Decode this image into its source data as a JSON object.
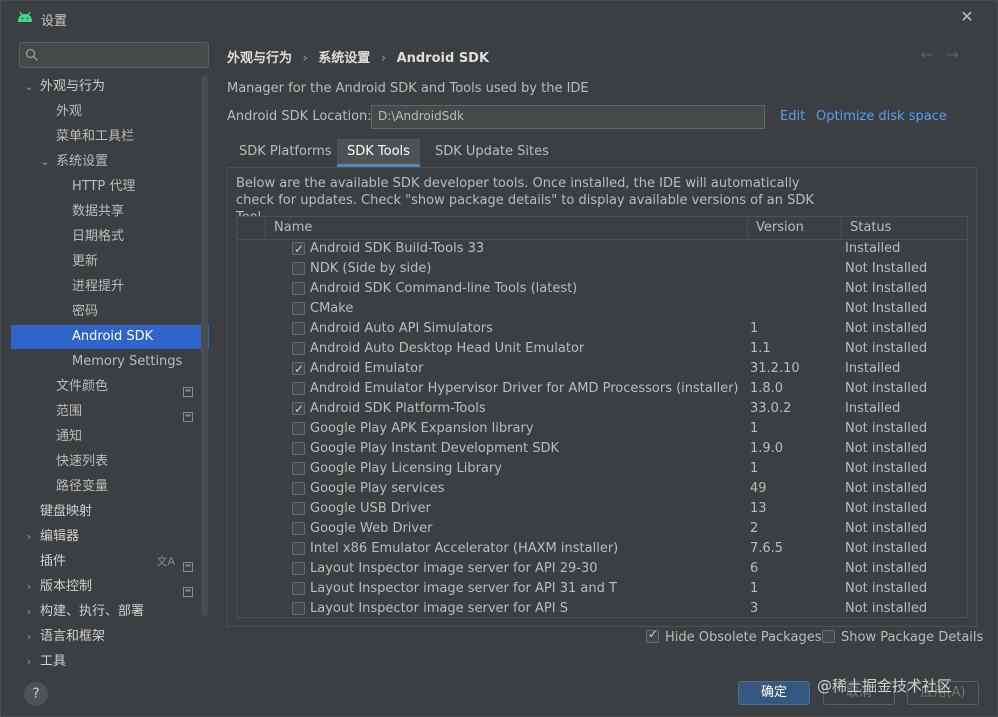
{
  "window": {
    "title": "设置",
    "close_icon": "close-icon",
    "app_icon": "android-icon"
  },
  "sidebar": {
    "search_placeholder": "",
    "items": [
      {
        "label": "外观与行为",
        "level": 0,
        "expand": "open",
        "bold": true
      },
      {
        "label": "外观",
        "level": 1
      },
      {
        "label": "菜单和工具栏",
        "level": 1
      },
      {
        "label": "系统设置",
        "level": 1,
        "expand": "open"
      },
      {
        "label": "HTTP 代理",
        "level": 2
      },
      {
        "label": "数据共享",
        "level": 2
      },
      {
        "label": "日期格式",
        "level": 2
      },
      {
        "label": "更新",
        "level": 2
      },
      {
        "label": "进程提升",
        "level": 2
      },
      {
        "label": "密码",
        "level": 2
      },
      {
        "label": "Android SDK",
        "level": 2,
        "selected": true
      },
      {
        "label": "Memory Settings",
        "level": 2
      },
      {
        "label": "文件颜色",
        "level": 1,
        "badge": true
      },
      {
        "label": "范围",
        "level": 1,
        "badge": true
      },
      {
        "label": "通知",
        "level": 1
      },
      {
        "label": "快速列表",
        "level": 1
      },
      {
        "label": "路径变量",
        "level": 1
      },
      {
        "label": "键盘映射",
        "level": 0,
        "bold": true
      },
      {
        "label": "编辑器",
        "level": 0,
        "expand": "closed",
        "bold": true
      },
      {
        "label": "插件",
        "level": 0,
        "bold": true,
        "badge": true,
        "translate": true
      },
      {
        "label": "版本控制",
        "level": 0,
        "expand": "closed",
        "bold": true,
        "badge": true
      },
      {
        "label": "构建、执行、部署",
        "level": 0,
        "expand": "closed",
        "bold": true
      },
      {
        "label": "语言和框架",
        "level": 0,
        "expand": "closed",
        "bold": true
      },
      {
        "label": "工具",
        "level": 0,
        "expand": "closed",
        "bold": true
      }
    ]
  },
  "breadcrumb": [
    "外观与行为",
    "系统设置",
    "Android SDK"
  ],
  "breadcrumb_sep": "›",
  "nav": {
    "back": "←",
    "forward": "→"
  },
  "description": "Manager for the Android SDK and Tools used by the IDE",
  "location": {
    "label": "Android SDK Location:",
    "value": "D:\\AndroidSdk",
    "edit": "Edit",
    "optimize": "Optimize disk space"
  },
  "tabs": [
    "SDK Platforms",
    "SDK Tools",
    "SDK Update Sites"
  ],
  "active_tab": 1,
  "panel_desc": "Below are the available SDK developer tools. Once installed, the IDE will automatically check for updates. Check \"show package details\" to display available versions of an SDK Tool.",
  "table": {
    "headers": {
      "name": "Name",
      "version": "Version",
      "status": "Status"
    },
    "rows": [
      {
        "checked": true,
        "name": "Android SDK Build-Tools 33",
        "version": "",
        "status": "Installed"
      },
      {
        "checked": false,
        "name": "NDK (Side by side)",
        "version": "",
        "status": "Not Installed"
      },
      {
        "checked": false,
        "name": "Android SDK Command-line Tools (latest)",
        "version": "",
        "status": "Not Installed"
      },
      {
        "checked": false,
        "name": "CMake",
        "version": "",
        "status": "Not Installed"
      },
      {
        "checked": false,
        "name": "Android Auto API Simulators",
        "version": "1",
        "status": "Not installed"
      },
      {
        "checked": false,
        "name": "Android Auto Desktop Head Unit Emulator",
        "version": "1.1",
        "status": "Not installed"
      },
      {
        "checked": true,
        "name": "Android Emulator",
        "version": "31.2.10",
        "status": "Installed"
      },
      {
        "checked": false,
        "name": "Android Emulator Hypervisor Driver for AMD Processors (installer)",
        "version": "1.8.0",
        "status": "Not installed"
      },
      {
        "checked": true,
        "name": "Android SDK Platform-Tools",
        "version": "33.0.2",
        "status": "Installed"
      },
      {
        "checked": false,
        "name": "Google Play APK Expansion library",
        "version": "1",
        "status": "Not installed"
      },
      {
        "checked": false,
        "name": "Google Play Instant Development SDK",
        "version": "1.9.0",
        "status": "Not installed"
      },
      {
        "checked": false,
        "name": "Google Play Licensing Library",
        "version": "1",
        "status": "Not installed"
      },
      {
        "checked": false,
        "name": "Google Play services",
        "version": "49",
        "status": "Not installed"
      },
      {
        "checked": false,
        "name": "Google USB Driver",
        "version": "13",
        "status": "Not installed"
      },
      {
        "checked": false,
        "name": "Google Web Driver",
        "version": "2",
        "status": "Not installed"
      },
      {
        "checked": false,
        "name": "Intel x86 Emulator Accelerator (HAXM installer)",
        "version": "7.6.5",
        "status": "Not installed"
      },
      {
        "checked": false,
        "name": "Layout Inspector image server for API 29-30",
        "version": "6",
        "status": "Not installed"
      },
      {
        "checked": false,
        "name": "Layout Inspector image server for API 31 and T",
        "version": "1",
        "status": "Not installed"
      },
      {
        "checked": false,
        "name": "Layout Inspector image server for API S",
        "version": "3",
        "status": "Not installed"
      }
    ]
  },
  "options": {
    "hide_obsolete": {
      "label": "Hide Obsolete Packages",
      "checked": true
    },
    "show_details": {
      "label": "Show Package Details",
      "checked": false
    }
  },
  "buttons": {
    "ok": "确定",
    "cancel": "取消",
    "apply": "应用(A)",
    "help": "?"
  },
  "watermark": "@稀土掘金技术社区",
  "colors": {
    "accent": "#2f65ca",
    "link": "#589df6",
    "primary_button": "#365880"
  }
}
